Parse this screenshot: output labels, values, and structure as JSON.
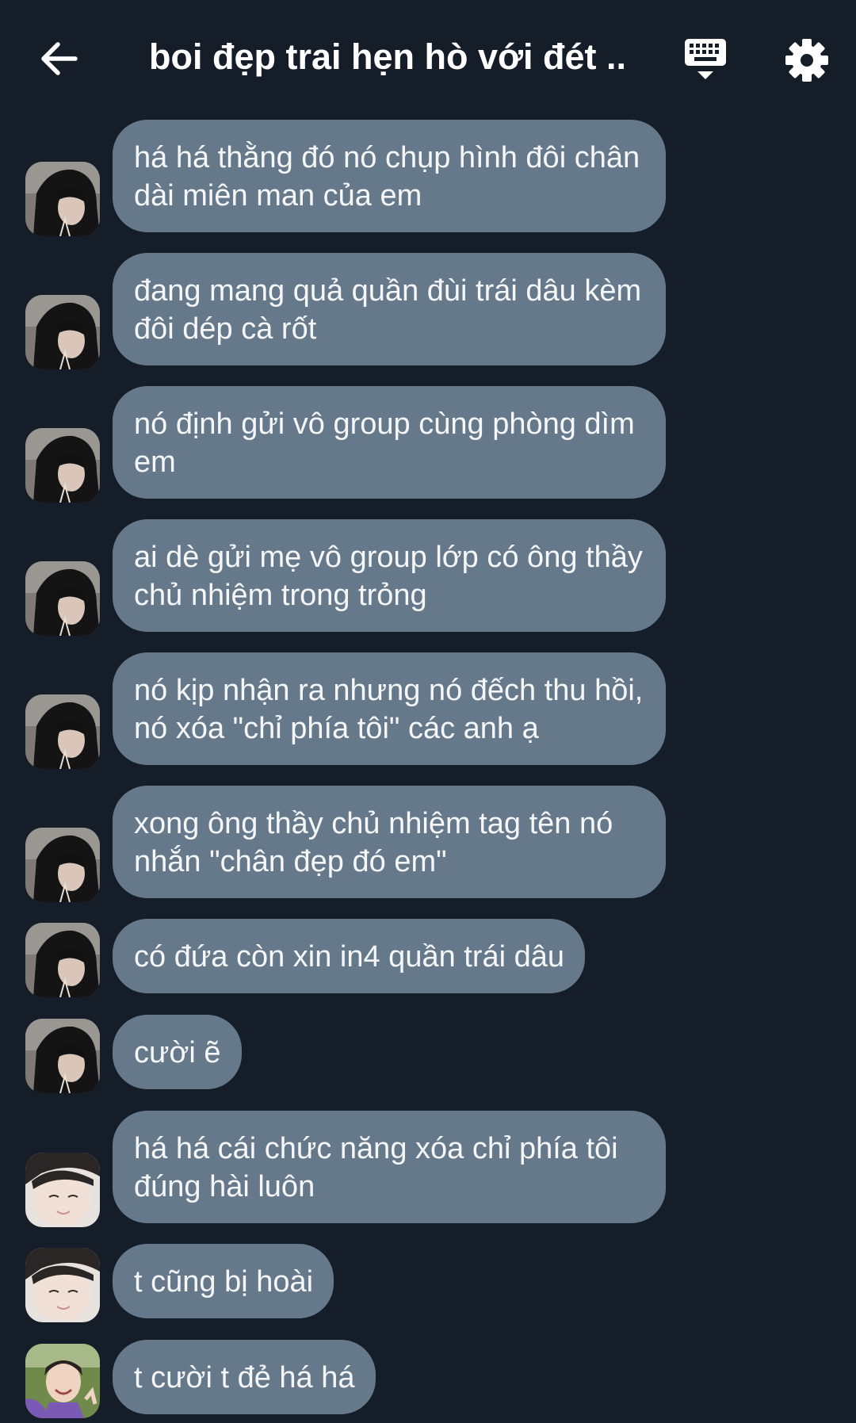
{
  "header": {
    "title": "boi đẹp trai hẹn hò với đét ..."
  },
  "messages": [
    {
      "text": "há há thằng đó nó chụp hình đôi chân dài miên man của em",
      "avatar": "hood"
    },
    {
      "text": "đang mang quả quần đùi trái dâu kèm đôi dép cà rốt",
      "avatar": "hood"
    },
    {
      "text": "nó định gửi vô group cùng phòng dìm em",
      "avatar": "hood"
    },
    {
      "text": "ai dè gửi mẹ vô group lớp có ông thầy chủ nhiệm trong trỏng",
      "avatar": "hood"
    },
    {
      "text": "nó kịp nhận ra nhưng nó đếch thu hồi, nó xóa \"chỉ phía tôi\" các anh ạ",
      "avatar": "hood"
    },
    {
      "text": "xong ông thầy chủ nhiệm tag tên nó nhắn \"chân đẹp đó em\"",
      "avatar": "hood"
    },
    {
      "text": "có đứa còn xin in4 quần trái dâu",
      "avatar": "hood"
    },
    {
      "text": "cười ẽ",
      "avatar": "hood"
    },
    {
      "text": "há há cái chức năng xóa chỉ phía tôi đúng hài luôn",
      "avatar": "face"
    },
    {
      "text": "t cũng bị hoài",
      "avatar": "face"
    },
    {
      "text": "t cười t đẻ há há",
      "avatar": "outdoor"
    }
  ],
  "colors": {
    "background": "#151d28",
    "bubble": "#66798a",
    "text": "#ffffff"
  },
  "icons": {
    "back": "arrow-left-icon",
    "keyboard": "keyboard-icon",
    "settings": "gear-icon"
  }
}
